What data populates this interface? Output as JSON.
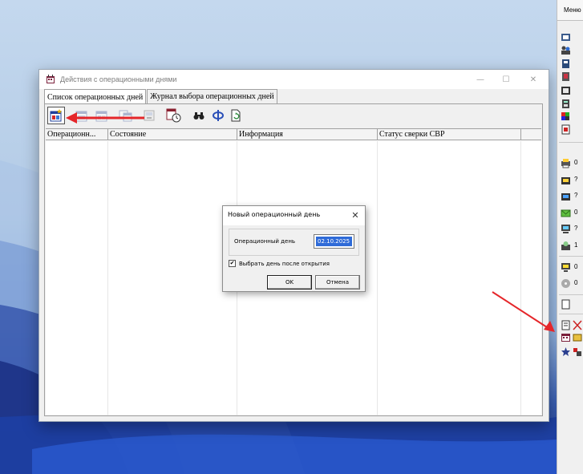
{
  "window": {
    "title": "Действия с операционными днями",
    "minimize_glyph": "—",
    "maximize_glyph": "☐",
    "close_glyph": "✕"
  },
  "tabs": [
    {
      "label": "Список операционных дней",
      "active": true
    },
    {
      "label": "Журнал выбора операционных дней",
      "active": false
    }
  ],
  "toolbar": {
    "buttons": [
      {
        "icon": "new-operational-day-icon",
        "enabled": true
      },
      {
        "icon": "open-day-icon",
        "enabled": false
      },
      {
        "icon": "close-day-icon",
        "enabled": false
      },
      {
        "icon": "day-group-icon",
        "enabled": false
      },
      {
        "icon": "archive-day-icon",
        "enabled": false
      },
      {
        "icon": "day-schedule-icon",
        "enabled": true
      },
      {
        "icon": "binoculars-icon",
        "enabled": true
      },
      {
        "icon": "filter-icon",
        "enabled": true
      },
      {
        "icon": "refresh-document-icon",
        "enabled": true
      }
    ]
  },
  "grid": {
    "columns": [
      "Операционн...",
      "Состояние",
      "Информация",
      "Статус сверки СВР"
    ],
    "rows": []
  },
  "dialog": {
    "title": "Новый операционный день",
    "close_glyph": "✕",
    "op_day_label": "Операционный день",
    "op_day_value": "02.10.2025",
    "checkbox_label": "Выбрать день после открытия",
    "checkbox_checked": true,
    "checkbox_mark": "✔",
    "ok_label": "OK",
    "cancel_label": "Отмена"
  },
  "menu_panel": {
    "label": "Меню",
    "items": [
      {
        "icon": "book-icon",
        "text": ""
      },
      {
        "icon": "people-icon",
        "text": ""
      },
      {
        "icon": "document-icon",
        "text": ""
      },
      {
        "icon": "ledger-icon",
        "text": ""
      },
      {
        "icon": "folder-icon",
        "text": ""
      },
      {
        "icon": "calculator-icon",
        "text": ""
      },
      {
        "icon": "color-chart-icon",
        "text": ""
      },
      {
        "icon": "pdf-icon",
        "text": ""
      },
      {
        "icon": "printer-icon",
        "text": "0"
      },
      {
        "icon": "inbox-icon",
        "text": "?"
      },
      {
        "icon": "outbox-icon",
        "text": "?"
      },
      {
        "icon": "mail-icon",
        "text": "0"
      },
      {
        "icon": "computer-icon",
        "text": "?"
      },
      {
        "icon": "network-icon",
        "text": "1"
      },
      {
        "icon": "monitor-icon",
        "text": "0"
      },
      {
        "icon": "cd-icon",
        "text": "0"
      },
      {
        "icon": "page-icon",
        "text": ""
      },
      {
        "icon": "report-icon",
        "text": ""
      },
      {
        "icon": "operational-days-icon",
        "text": ""
      },
      {
        "icon": "star-icon",
        "text": ""
      }
    ]
  },
  "colors": {
    "accent": "#2f6bd8",
    "annotation_red": "#e5262a",
    "window_bg": "#f0f0f0"
  }
}
